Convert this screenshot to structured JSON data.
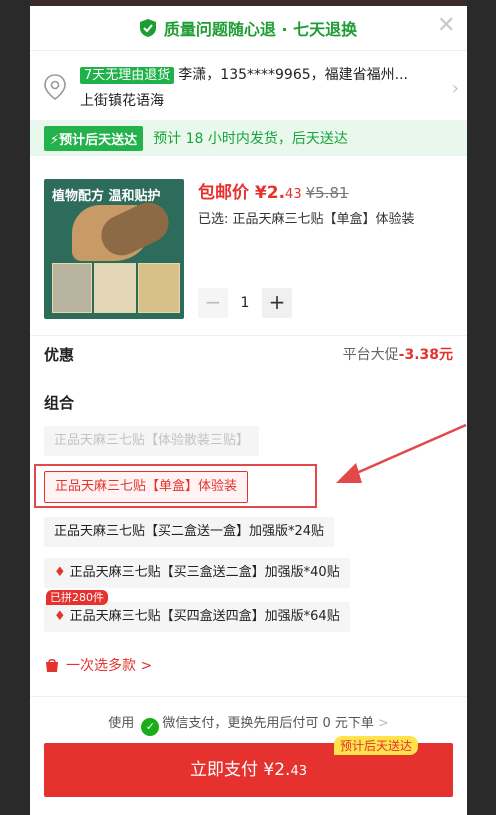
{
  "header": {
    "guarantee": "质量问题随心退 · 七天退换",
    "close_glyph": "✕"
  },
  "address": {
    "tag": "7天无理由退货",
    "line1": "李潇，135****9965，福建省福州...",
    "line2": "上街镇花语海"
  },
  "shipping": {
    "badge": "⚡预计后天送达",
    "text": "预计 18 小时内发货，后天送达"
  },
  "product": {
    "image_caption": "植物配方 温和贴护",
    "price_prefix": "包邮价 ¥",
    "price_int": "2.",
    "price_dec": "43",
    "original_price": "¥5.81",
    "selected": "已选: 正品天麻三七贴【单盒】体验装",
    "quantity": "1"
  },
  "promo": {
    "label": "优惠",
    "desc": "平台大促",
    "amount": "-3.38元"
  },
  "combo": {
    "title": "组合",
    "options": [
      {
        "label": "正品天麻三七贴【体验散装三贴】",
        "state": "disabled",
        "hot": false
      },
      {
        "label": "正品天麻三七贴【单盒】体验装",
        "state": "selected",
        "hot": false
      },
      {
        "label": "正品天麻三七贴【买二盒送一盒】加强版*24贴",
        "state": "normal",
        "hot": false
      },
      {
        "label": "正品天麻三七贴【买三盒送二盒】加强版*40贴",
        "state": "normal",
        "hot": true
      },
      {
        "label": "正品天麻三七贴【买四盒送四盒】加强版*64贴",
        "state": "normal",
        "hot": true
      }
    ],
    "group_badge": "已拼280件",
    "multi_select": "一次选多款 >"
  },
  "payment": {
    "prefix": "使用",
    "method": "微信支付，更换先用后付可 0 元下单",
    "chevron": ">"
  },
  "submit": {
    "label": "立即支付 ¥2.",
    "decimal": "43",
    "badge": "预计后天送达"
  },
  "colors": {
    "accent_red": "#e5322e",
    "accent_green": "#20b14a"
  }
}
